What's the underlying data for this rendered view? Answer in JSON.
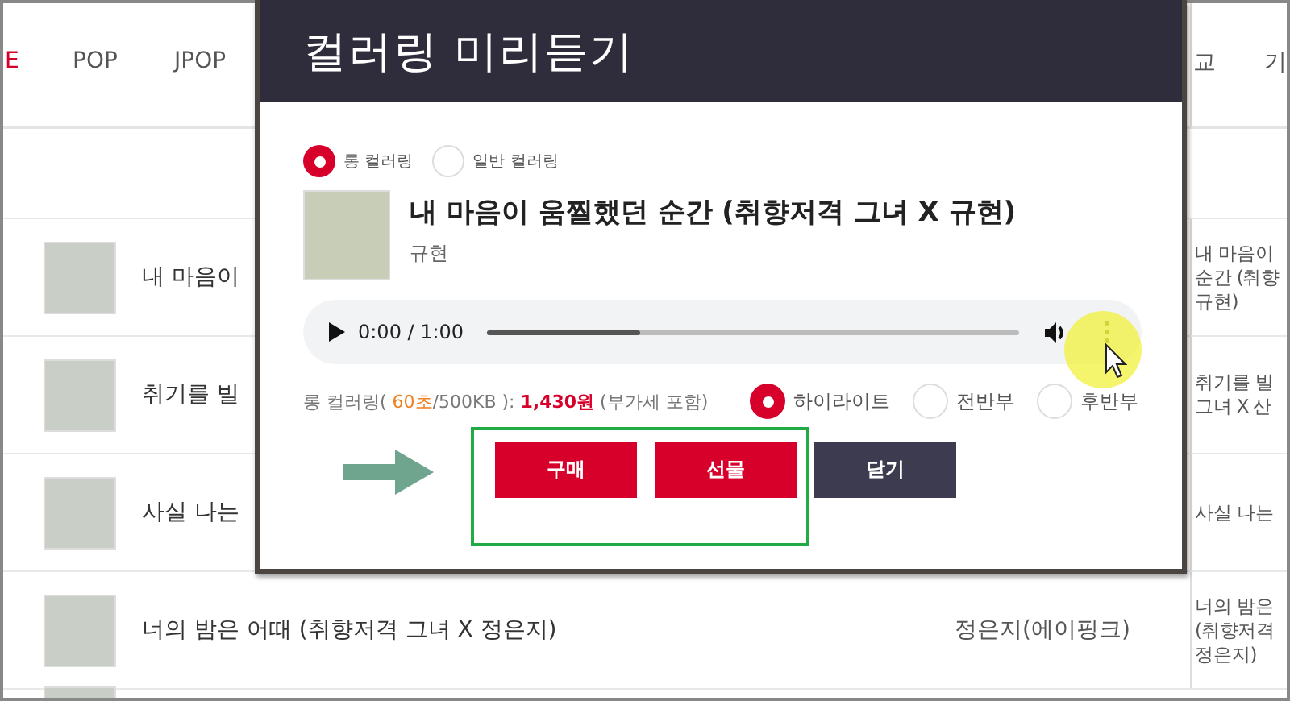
{
  "tabs": [
    {
      "label": "E",
      "selected": true
    },
    {
      "label": "POP",
      "selected": false
    },
    {
      "label": "JPOP",
      "selected": false
    },
    {
      "label": "교",
      "selected": false
    },
    {
      "label": "기",
      "selected": false
    }
  ],
  "rows": [
    {
      "title": "내 마음이",
      "artist_lines": [
        "내 마음이",
        "순간 (취향",
        "규현)"
      ]
    },
    {
      "title": "취기를 빌",
      "artist_lines": [
        "취기를 빌",
        "그녀 X 산"
      ]
    },
    {
      "title": "사실 나는",
      "artist_lines": [
        "사실 나는"
      ]
    },
    {
      "title": "너의 밤은 어때 (취향저격 그녀 X 정은지)",
      "artist": "정은지(에이핑크)",
      "artist_lines": [
        "너의 밤은",
        "(취향저격",
        "정은지)"
      ]
    }
  ],
  "dialog": {
    "title": "컬러링 미리듣기",
    "types": [
      {
        "label": "롱 컬러링",
        "selected": true
      },
      {
        "label": "일반 컬러링",
        "selected": false
      }
    ],
    "song": {
      "title": "내 마음이 움찔했던 순간 (취향저격 그녀 X 규현)",
      "artist": "규현"
    },
    "player": {
      "time": "0:00 / 1:00",
      "level": 0.29
    },
    "price_parts": [
      {
        "kind": "plain",
        "text": "롱 컬러링( "
      },
      {
        "kind": "duration",
        "text": "60초"
      },
      {
        "kind": "plain",
        "text": "/500KB ): "
      },
      {
        "kind": "amount",
        "text": "1,430원"
      },
      {
        "kind": "plain",
        "text": " (부가세 포함)"
      }
    ],
    "sections": [
      {
        "label": "하이라이트",
        "selected": true
      },
      {
        "label": "전반부",
        "selected": false
      },
      {
        "label": "후반부",
        "selected": false
      }
    ],
    "buttons": [
      {
        "label": "구매",
        "kind": "primary"
      },
      {
        "label": "선물",
        "kind": "primary"
      },
      {
        "label": "닫기",
        "kind": "secondary"
      }
    ]
  }
}
